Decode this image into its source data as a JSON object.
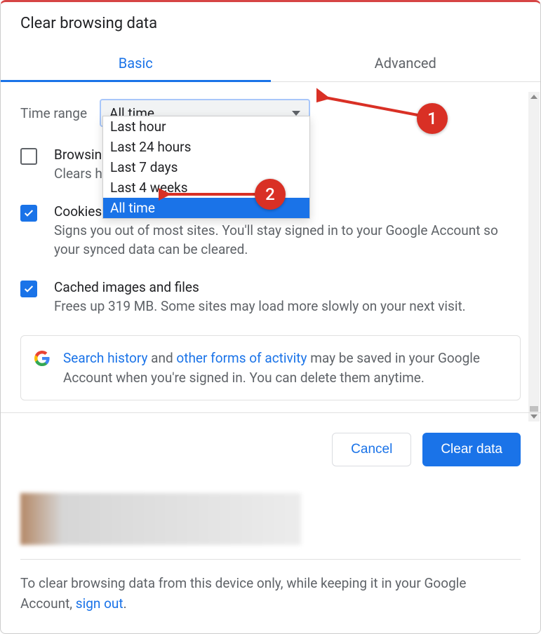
{
  "dialog": {
    "title": "Clear browsing data",
    "tabs": [
      {
        "label": "Basic",
        "active": true
      },
      {
        "label": "Advanced",
        "active": false
      }
    ],
    "time_range": {
      "label": "Time range",
      "selected": "All time",
      "options": [
        "Last hour",
        "Last 24 hours",
        "Last 7 days",
        "Last 4 weeks",
        "All time"
      ]
    },
    "items": [
      {
        "checked": false,
        "title": "Browsing history",
        "desc_partial": "Clears history"
      },
      {
        "checked": true,
        "title": "Cookies and other site data",
        "desc": "Signs you out of most sites. You'll stay signed in to your Google Account so your synced data can be cleared."
      },
      {
        "checked": true,
        "title": "Cached images and files",
        "desc": "Frees up 319 MB. Some sites may load more slowly on your next visit."
      }
    ],
    "infobox": {
      "link1": "Search history",
      "middle1": " and ",
      "link2": "other forms of activity",
      "rest": " may be saved in your Google Account when you're signed in. You can delete them anytime."
    },
    "buttons": {
      "cancel": "Cancel",
      "clear": "Clear data"
    },
    "bottom_note": {
      "text": "To clear browsing data from this device only, while keeping it in your Google Account, ",
      "link": "sign out",
      "suffix": "."
    }
  },
  "annotations": [
    {
      "label": "1"
    },
    {
      "label": "2"
    }
  ]
}
